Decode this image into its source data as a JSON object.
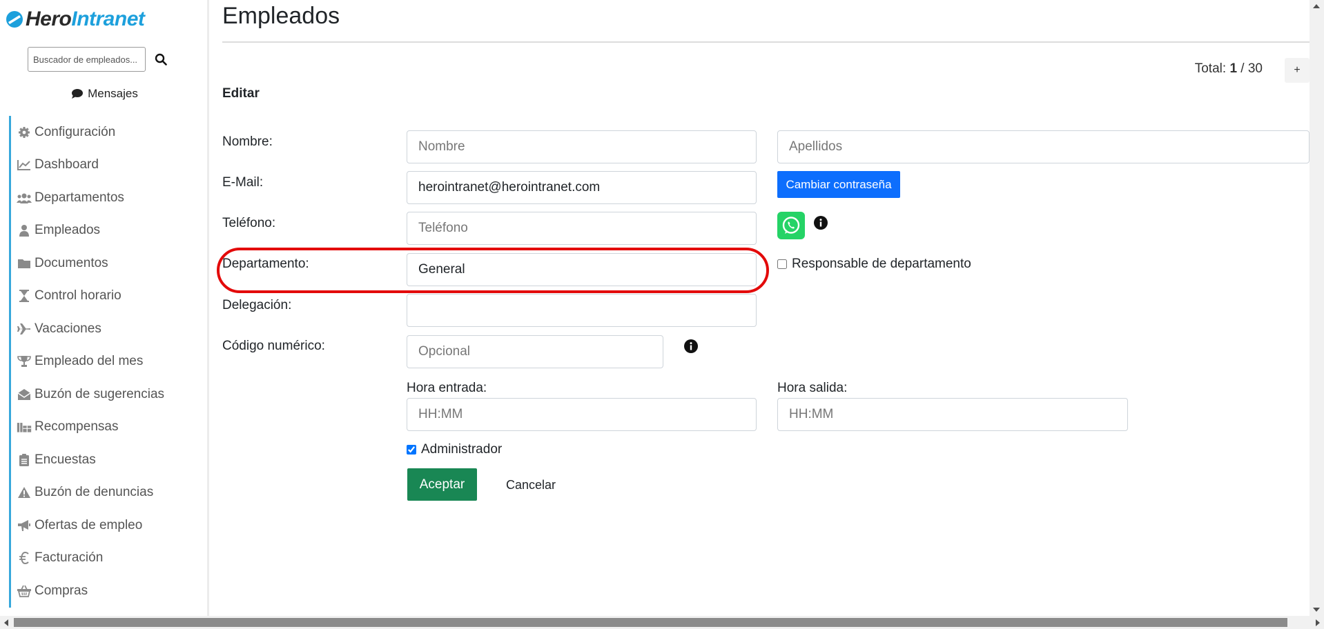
{
  "sidebar": {
    "logo": {
      "hero": "Hero",
      "intranet": "Intranet"
    },
    "search": {
      "placeholder": "Buscador de empleados..."
    },
    "messages_label": "Mensajes",
    "items": [
      {
        "label": "Configuración",
        "icon": "gear-icon"
      },
      {
        "label": "Dashboard",
        "icon": "line-chart-icon"
      },
      {
        "label": "Departamentos",
        "icon": "users-icon"
      },
      {
        "label": "Empleados",
        "icon": "user-icon"
      },
      {
        "label": "Documentos",
        "icon": "folder-icon"
      },
      {
        "label": "Control horario",
        "icon": "hourglass-icon"
      },
      {
        "label": "Vacaciones",
        "icon": "plane-icon"
      },
      {
        "label": "Empleado del mes",
        "icon": "trophy-icon"
      },
      {
        "label": "Buzón de sugerencias",
        "icon": "envelope-open-icon"
      },
      {
        "label": "Recompensas",
        "icon": "gifts-icon"
      },
      {
        "label": "Encuestas",
        "icon": "clipboard-icon"
      },
      {
        "label": "Buzón de denuncias",
        "icon": "warning-icon"
      },
      {
        "label": "Ofertas de empleo",
        "icon": "megaphone-icon"
      },
      {
        "label": "Facturación",
        "icon": "euro-icon"
      },
      {
        "label": "Compras",
        "icon": "basket-icon"
      }
    ]
  },
  "main": {
    "title": "Empleados",
    "total": {
      "prefix": "Total:",
      "current": "1",
      "separator": "/",
      "count": "30"
    },
    "add_label": "+",
    "section_title": "Editar",
    "form": {
      "nombre_label": "Nombre:",
      "nombre_placeholder": "Nombre",
      "apellidos_placeholder": "Apellidos",
      "email_label": "E-Mail:",
      "email_value": "herointranet@herointranet.com",
      "change_password_label": "Cambiar contraseña",
      "telefono_label": "Teléfono:",
      "telefono_placeholder": "Teléfono",
      "departamento_label": "Departamento:",
      "departamento_value": "General",
      "responsable_label": "Responsable de departamento",
      "delegacion_label": "Delegación:",
      "delegacion_value": "",
      "codigo_label": "Código numérico:",
      "codigo_placeholder": "Opcional",
      "hora_entrada_label": "Hora entrada:",
      "hora_entrada_placeholder": "HH:MM",
      "hora_salida_label": "Hora salida:",
      "hora_salida_placeholder": "HH:MM",
      "administrador_label": "Administrador",
      "administrador_checked": true,
      "responsable_checked": false,
      "accept_label": "Aceptar",
      "cancel_label": "Cancelar"
    },
    "colors": {
      "primary": "#0d6efd",
      "success": "#198754",
      "highlight": "#e30a0a",
      "whatsapp": "#25d366",
      "sidebar_accent": "#37a8dc"
    }
  }
}
